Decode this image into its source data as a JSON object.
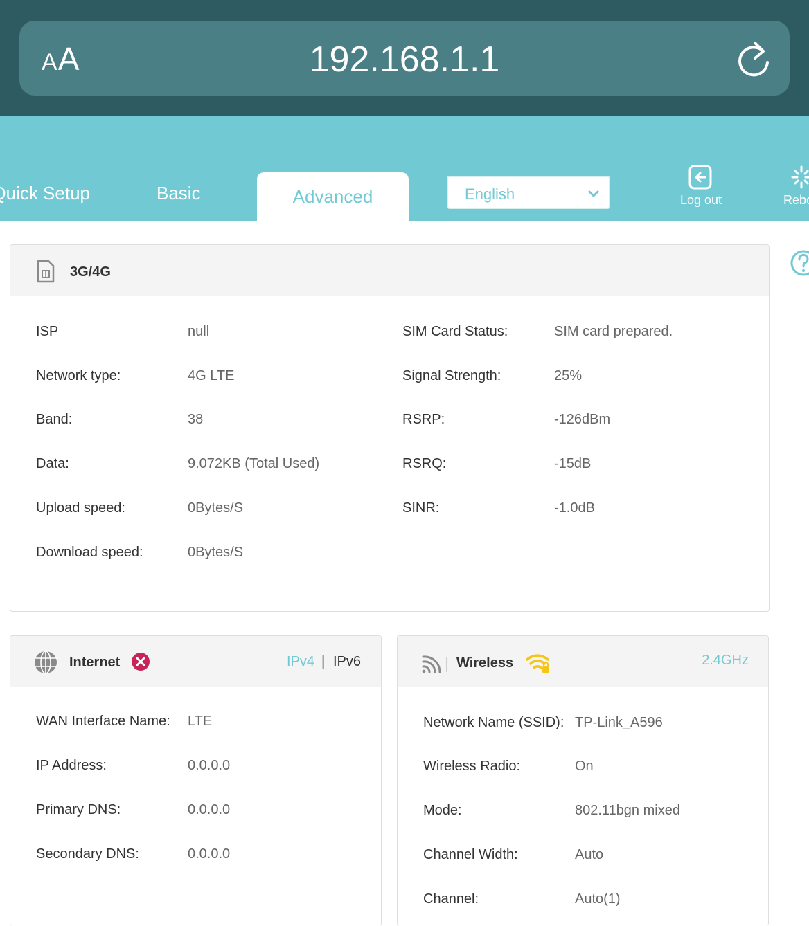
{
  "browser": {
    "text_size_small": "A",
    "text_size_large": "A",
    "url": "192.168.1.1"
  },
  "nav": {
    "tabs": {
      "quick_setup": "Quick Setup",
      "basic": "Basic",
      "advanced": "Advanced"
    },
    "language": "English",
    "logout_label": "Log out",
    "reboot_label": "Reboot"
  },
  "lte": {
    "title": "3G/4G",
    "left": [
      {
        "label": "ISP",
        "value": "null"
      },
      {
        "label": "Network type:",
        "value": "4G LTE"
      },
      {
        "label": "Band:",
        "value": "38"
      },
      {
        "label": "Data:",
        "value": "9.072KB (Total Used)"
      },
      {
        "label": "Upload speed:",
        "value": "0Bytes/S"
      },
      {
        "label": "Download speed:",
        "value": "0Bytes/S"
      }
    ],
    "right": [
      {
        "label": "SIM Card Status:",
        "value": "SIM card prepared."
      },
      {
        "label": "Signal Strength:",
        "value": "25%"
      },
      {
        "label": "RSRP:",
        "value": "-126dBm"
      },
      {
        "label": "RSRQ:",
        "value": "-15dB"
      },
      {
        "label": "SINR:",
        "value": "-1.0dB"
      }
    ]
  },
  "internet": {
    "title": "Internet",
    "ipv4": "IPv4",
    "separator": "|",
    "ipv6": "IPv6",
    "rows": [
      {
        "label": "WAN Interface Name:",
        "value": "LTE"
      },
      {
        "label": "IP Address:",
        "value": "0.0.0.0"
      },
      {
        "label": "Primary DNS:",
        "value": "0.0.0.0"
      },
      {
        "label": "Secondary DNS:",
        "value": "0.0.0.0"
      }
    ]
  },
  "wireless": {
    "title": "Wireless",
    "band": "2.4GHz",
    "rows": [
      {
        "label": "Network Name (SSID):",
        "value": "TP-Link_A596"
      },
      {
        "label": "Wireless Radio:",
        "value": "On"
      },
      {
        "label": "Mode:",
        "value": "802.11bgn mixed"
      },
      {
        "label": "Channel Width:",
        "value": "Auto"
      },
      {
        "label": "Channel:",
        "value": "Auto(1)"
      }
    ]
  },
  "colors": {
    "accent": "#71c9d3",
    "browser_bar": "#2e5a62",
    "url_pill": "#4a7f86",
    "error": "#c8245a",
    "wifi_warning": "#f5c518"
  }
}
